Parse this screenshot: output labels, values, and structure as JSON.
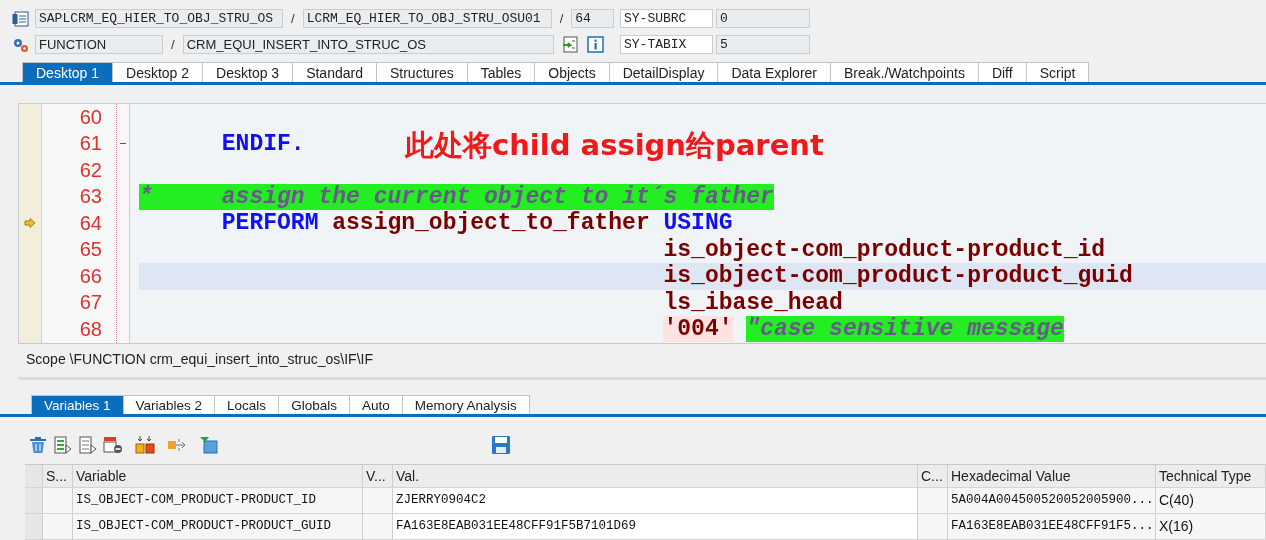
{
  "header": {
    "rows": [
      {
        "parts": [
          {
            "kind": "program",
            "text": "SAPLCRM_EQ_HIER_TO_OBJ_STRU_OS"
          },
          {
            "kind": "separator",
            "text": "/"
          },
          {
            "kind": "include",
            "text": "LCRM_EQ_HIER_TO_OBJ_STRU_OSU01"
          },
          {
            "kind": "separator",
            "text": "/"
          },
          {
            "kind": "line",
            "text": "64"
          }
        ],
        "sysvar": {
          "name": "SY-SUBRC",
          "value": "0"
        }
      },
      {
        "parts": [
          {
            "kind": "event_type",
            "text": "FUNCTION"
          },
          {
            "kind": "separator",
            "text": "/"
          },
          {
            "kind": "event_name",
            "text": "CRM_EQUI_INSERT_INTO_STRUC_OS"
          }
        ],
        "sysvar": {
          "name": "SY-TABIX",
          "value": "5"
        }
      }
    ]
  },
  "desktop_tabs": [
    {
      "label": "Desktop 1",
      "selected": true
    },
    {
      "label": "Desktop 2",
      "selected": false
    },
    {
      "label": "Desktop 3",
      "selected": false
    },
    {
      "label": "Standard",
      "selected": false
    },
    {
      "label": "Structures",
      "selected": false
    },
    {
      "label": "Tables",
      "selected": false
    },
    {
      "label": "Objects",
      "selected": false
    },
    {
      "label": "DetailDisplay",
      "selected": false
    },
    {
      "label": "Data Explorer",
      "selected": false
    },
    {
      "label": "Break./Watchpoints",
      "selected": false
    },
    {
      "label": "Diff",
      "selected": false
    },
    {
      "label": "Script",
      "selected": false
    }
  ],
  "editor": {
    "annotation": "此处将child assign给parent",
    "lines": [
      {
        "number": "60",
        "current": false,
        "highlighted": false,
        "fold": false
      },
      {
        "number": "61",
        "current": false,
        "highlighted": false,
        "fold": true,
        "kind": "statement",
        "tokens": [
          {
            "kind": "keyword",
            "text": "ENDIF."
          }
        ]
      },
      {
        "number": "62",
        "current": false,
        "highlighted": false,
        "fold": false
      },
      {
        "number": "63",
        "current": false,
        "highlighted": false,
        "fold": false,
        "kind": "comment",
        "tokens": [
          {
            "kind": "comment",
            "text": "*     assign the current object to it´s father"
          }
        ]
      },
      {
        "number": "64",
        "current": true,
        "highlighted": false,
        "fold": false,
        "kind": "statement",
        "tokens": [
          {
            "kind": "keyword",
            "text": "PERFORM"
          },
          {
            "kind": "identifier",
            "text": "assign_object_to_father"
          },
          {
            "kind": "keyword",
            "text": "USING"
          }
        ]
      },
      {
        "number": "65",
        "current": false,
        "highlighted": false,
        "fold": false,
        "kind": "argument",
        "tokens": [
          {
            "kind": "identifier",
            "text": "is_object-com_product-product_id"
          }
        ]
      },
      {
        "number": "66",
        "current": false,
        "highlighted": true,
        "fold": false,
        "kind": "argument",
        "tokens": [
          {
            "kind": "identifier",
            "text": "is_object-com_product-product_guid"
          }
        ]
      },
      {
        "number": "67",
        "current": false,
        "highlighted": false,
        "fold": false,
        "kind": "argument",
        "tokens": [
          {
            "kind": "identifier",
            "text": "ls_ibase_head"
          }
        ]
      },
      {
        "number": "68",
        "current": false,
        "highlighted": false,
        "fold": false,
        "kind": "argument",
        "tokens": [
          {
            "kind": "literal",
            "text": "'004'"
          },
          {
            "kind": "string_comment",
            "text": "\"case sensitive message"
          }
        ]
      }
    ]
  },
  "scope": "Scope \\FUNCTION crm_equi_insert_into_struc_os\\IF\\IF",
  "variable_tabs": [
    {
      "label": "Variables 1",
      "selected": true
    },
    {
      "label": "Variables 2",
      "selected": false
    },
    {
      "label": "Locals",
      "selected": false
    },
    {
      "label": "Globals",
      "selected": false
    },
    {
      "label": "Auto",
      "selected": false
    },
    {
      "label": "Memory Analysis",
      "selected": false
    }
  ],
  "table": {
    "columns": [
      {
        "kind": "narrow",
        "label": "S..."
      },
      {
        "kind": "variable",
        "label": "Variable"
      },
      {
        "kind": "narrow",
        "label": "V..."
      },
      {
        "kind": "value",
        "label": "Val."
      },
      {
        "kind": "narrow",
        "label": "C..."
      },
      {
        "kind": "hex",
        "label": "Hexadecimal Value"
      },
      {
        "kind": "type",
        "label": "Technical Type"
      }
    ],
    "rows": [
      {
        "cells": [
          "",
          "IS_OBJECT-COM_PRODUCT-PRODUCT_ID",
          "",
          "ZJERRY0904C2",
          "",
          "5A004A004500520052005900...",
          "C(40)"
        ]
      },
      {
        "cells": [
          "",
          "IS_OBJECT-COM_PRODUCT-PRODUCT_GUID",
          "",
          "FA163E8EAB031EE48CFF91F5B7101D69",
          "",
          "FA163E8EAB031EE48CFF91F5...",
          "X(16)"
        ]
      }
    ]
  }
}
